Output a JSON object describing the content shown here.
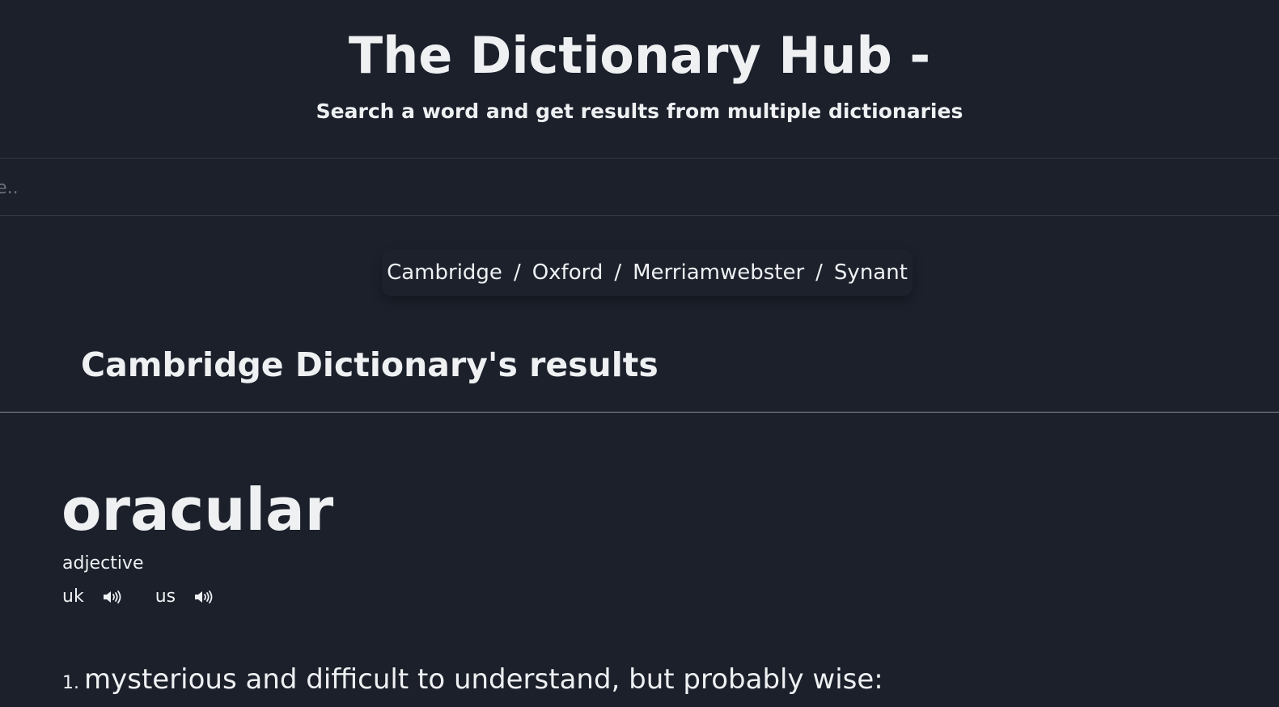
{
  "header": {
    "title": "The Dictionary Hub -",
    "subtitle": "Search a word and get results from multiple dictionaries"
  },
  "search": {
    "placeholder": "Type a word here..",
    "value": ""
  },
  "dictionaries": {
    "items": [
      "Cambridge",
      "Oxford",
      "Merriamwebster",
      "Synant"
    ],
    "separator": "/"
  },
  "results": {
    "heading": "Cambridge Dictionary's results",
    "word": "oracular",
    "part_of_speech": "adjective",
    "pronunciations": [
      {
        "label": "uk",
        "icon": "speaker-icon"
      },
      {
        "label": "us",
        "icon": "speaker-icon"
      }
    ],
    "definitions": [
      {
        "number": "1.",
        "text": "mysterious and difficult to understand, but probably wise:"
      }
    ]
  },
  "colors": {
    "background": "#1b202b",
    "text": "#eef0f2",
    "border": "#343a46",
    "divider": "#8a8f98"
  }
}
